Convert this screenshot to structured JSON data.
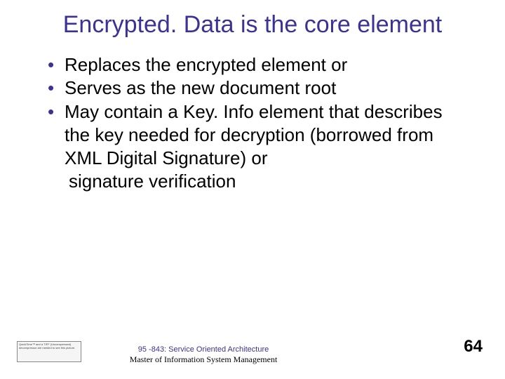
{
  "title": "Encrypted. Data is the core element",
  "bullets": [
    "Replaces the encrypted element or",
    "Serves as the new document root",
    "May contain a Key. Info element that describes the key needed for decryption (borrowed from XML Digital Signature) or"
  ],
  "trailing_line": " signature verification",
  "footer": {
    "course_code": "95 -843: Service Oriented Architecture",
    "program_line": "Master of Information System Management",
    "slide_number": "64",
    "placeholder_text": "QuickTime™ and a TIFF (Uncompressed) decompressor are needed to see this picture."
  }
}
